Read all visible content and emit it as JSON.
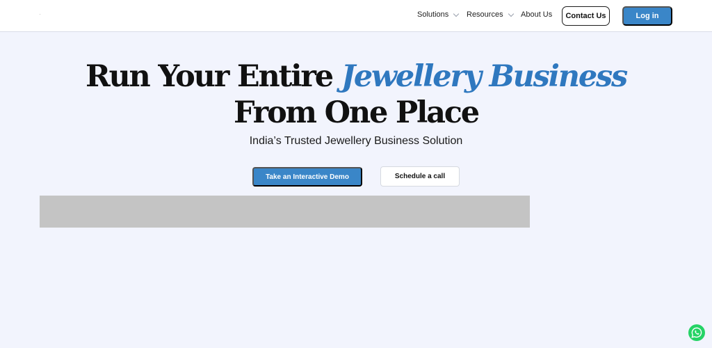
{
  "header": {
    "nav": [
      {
        "label": "Solutions",
        "has_dropdown": true
      },
      {
        "label": "Resources",
        "has_dropdown": true
      },
      {
        "label": "About Us",
        "has_dropdown": false
      }
    ],
    "contact_label": "Contact Us",
    "login_label": "Log in"
  },
  "hero": {
    "title_line1_plain": "Run Your Entire ",
    "title_line1_accent": "Jewellery Business",
    "title_line2": "From One Place",
    "subtitle": "India’s Trusted Jewellery Business Solution",
    "primary_cta": "Take an Interactive Demo",
    "secondary_cta": "Schedule a call"
  },
  "floating": {
    "whatsapp_icon": "whatsapp-icon"
  },
  "colors": {
    "background": "#f2f4fd",
    "brand_blue": "#3a86c8",
    "accent_text": "#2f78bf",
    "whatsapp_green": "#25d366"
  }
}
